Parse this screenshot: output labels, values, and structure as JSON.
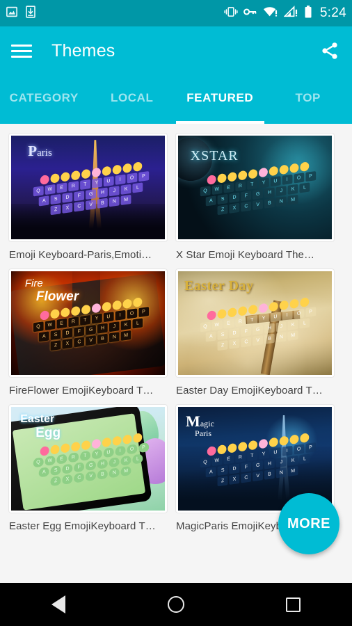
{
  "statusbar": {
    "time": "5:24",
    "left_icons": [
      "image-icon",
      "download-icon"
    ],
    "right_icons": [
      "vibrate-icon",
      "vpn-key-icon",
      "wifi-alert-icon",
      "signal-alert-icon",
      "battery-icon"
    ]
  },
  "appbar": {
    "title": "Themes",
    "menu_icon": "hamburger-menu-icon",
    "share_icon": "share-icon",
    "background_color": "#00bcd4"
  },
  "tabs": [
    {
      "label": "CATEGORY",
      "active": false
    },
    {
      "label": "LOCAL",
      "active": false
    },
    {
      "label": "FEATURED",
      "active": true
    },
    {
      "label": "TOP",
      "active": false
    }
  ],
  "themes": [
    {
      "label": "Emoji Keyboard-Paris,Emoti…",
      "art_title_small": "aris",
      "art_title_big": "P"
    },
    {
      "label": "X Star Emoji Keyboard The…",
      "art_title": "XSTAR"
    },
    {
      "label": "FireFlower EmojiKeyboard T…",
      "art_title_small": "Fire",
      "art_title_big": "Flower"
    },
    {
      "label": "Easter Day EmojiKeyboard T…",
      "art_title": "Easter Day"
    },
    {
      "label": "Easter Egg EmojiKeyboard T…",
      "art_title_small": "Easter",
      "art_title_big": "Egg"
    },
    {
      "label": "MagicParis EmojiKeyboard…",
      "art_title_big": "M",
      "art_title_small": "agic\nParis"
    }
  ],
  "fab": {
    "label": "MORE",
    "color": "#00bcd4"
  },
  "navbar": {
    "back": "back-icon",
    "home": "home-icon",
    "recents": "recents-icon"
  },
  "keyboard_art": {
    "row1": "QWERTYUIOP",
    "row2": "ASDFGHJKL",
    "row3": "ZXCVBNM"
  }
}
